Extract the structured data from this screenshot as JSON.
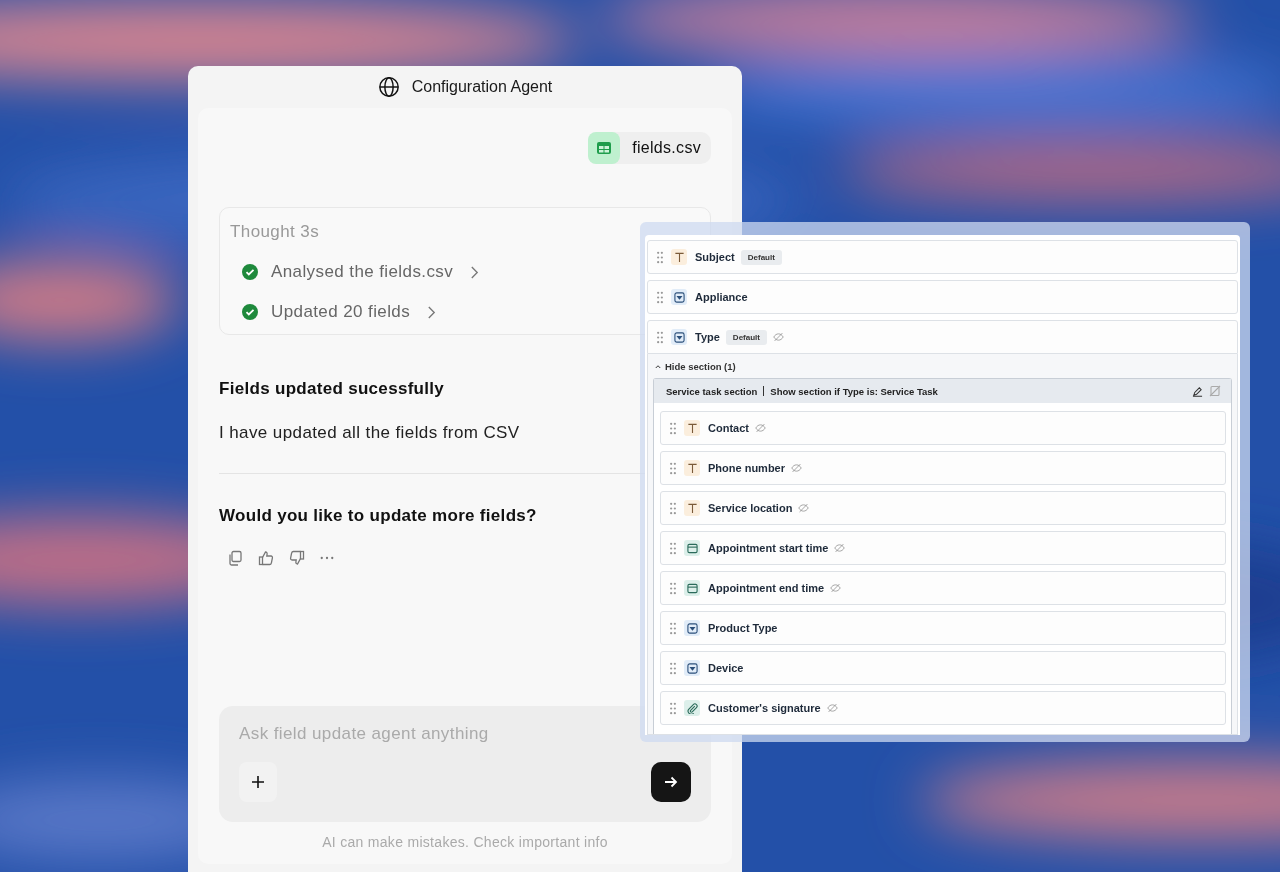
{
  "agent": {
    "title": "Configuration Agent",
    "attachment": "fields.csv",
    "thought": {
      "title": "Thought 3s",
      "steps": [
        {
          "label": "Analysed the fields.csv",
          "done": true
        },
        {
          "label": "Updated 20 fields",
          "done": true
        }
      ]
    },
    "heading": "Fields updated sucessfully",
    "message": "I have updated all the fields from CSV",
    "question": "Would you like to update more fields?",
    "composer": {
      "placeholder": "Ask field update agent anything"
    },
    "disclaimer": "AI can make mistakes. Check important info"
  },
  "form": {
    "fields": [
      {
        "kind": "text",
        "label": "Subject",
        "badge": "Default",
        "hidden": false
      },
      {
        "kind": "dropdown",
        "label": "Appliance",
        "hidden": false
      },
      {
        "kind": "dropdown",
        "label": "Type",
        "badge": "Default",
        "hidden": true
      }
    ],
    "toggle": "Hide section (1)",
    "section": {
      "title": "Service task section",
      "condition": "Show section if Type is: Service Task",
      "fields": [
        {
          "kind": "text",
          "label": "Contact",
          "hidden": true
        },
        {
          "kind": "text",
          "label": "Phone number",
          "hidden": true
        },
        {
          "kind": "text",
          "label": "Service location",
          "hidden": true
        },
        {
          "kind": "date",
          "label": "Appointment start time",
          "hidden": true
        },
        {
          "kind": "date",
          "label": "Appointment end time",
          "hidden": true
        },
        {
          "kind": "dropdown",
          "label": "Product Type",
          "hidden": false
        },
        {
          "kind": "dropdown",
          "label": "Device",
          "hidden": false
        },
        {
          "kind": "attachment",
          "label": "Customer's signature",
          "hidden": true
        }
      ]
    }
  }
}
